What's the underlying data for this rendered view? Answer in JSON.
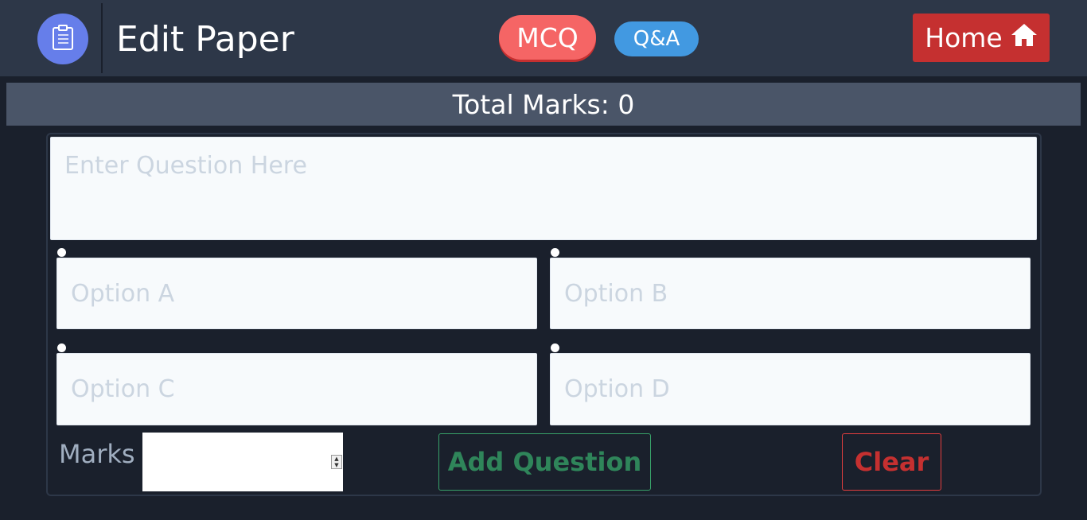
{
  "header": {
    "title": "Edit Paper",
    "logo_icon": "clipboard-icon",
    "tabs": [
      {
        "label": "MCQ",
        "color": "#f56565",
        "active": true
      },
      {
        "label": "Q&A",
        "color": "#4299e1",
        "active": false
      }
    ],
    "home": {
      "label": "Home",
      "icon": "home-icon",
      "color": "#c53030"
    }
  },
  "summary": {
    "total_marks_label": "Total Marks: 0"
  },
  "form": {
    "question_placeholder": "Enter Question Here",
    "options": [
      {
        "placeholder": "Option A"
      },
      {
        "placeholder": "Option B"
      },
      {
        "placeholder": "Option C"
      },
      {
        "placeholder": "Option D"
      }
    ],
    "marks_label": "Marks",
    "marks_value": "",
    "add_label": "Add Question",
    "clear_label": "Clear"
  },
  "colors": {
    "background": "#1a202c",
    "header": "#2d3748",
    "summary_bar": "#4a5568",
    "logo": "#667eea",
    "add_accent": "#2f855a",
    "clear_accent": "#c53030"
  }
}
